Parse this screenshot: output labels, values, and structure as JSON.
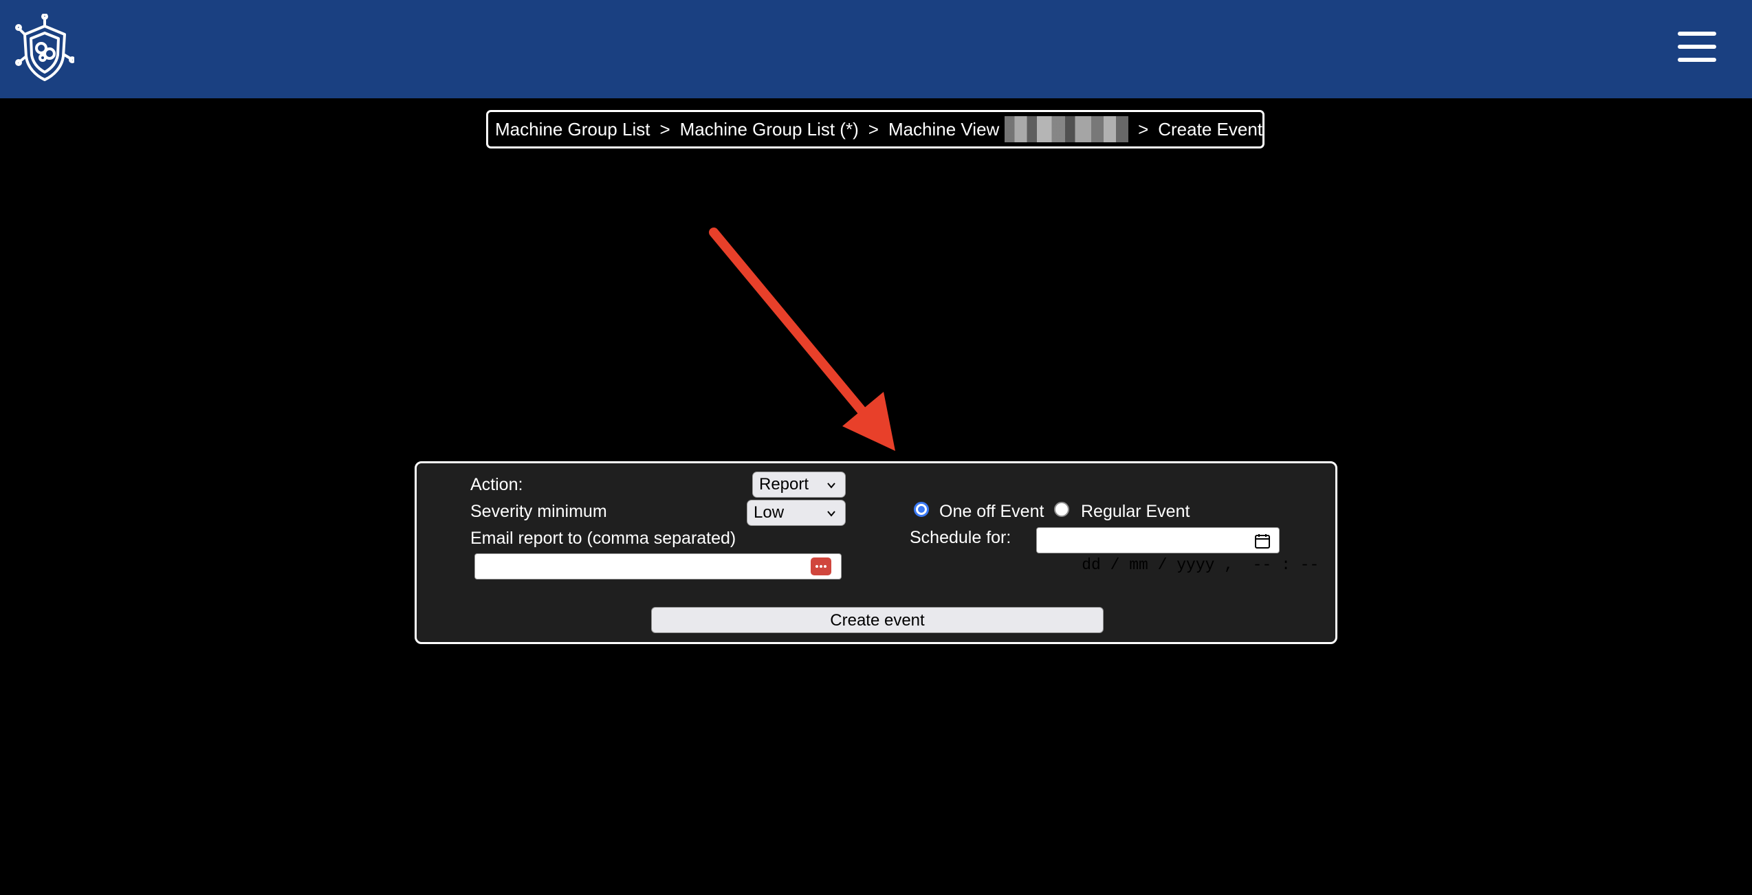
{
  "header": {
    "background_color": "#1a4081",
    "logo_icon": "shield-circuit-logo-icon",
    "menu_icon": "hamburger-menu-icon"
  },
  "breadcrumb": {
    "items": [
      {
        "label": "Machine Group List"
      },
      {
        "label": "Machine Group List (*)"
      },
      {
        "label": "Machine View"
      },
      {
        "label": "Create Event"
      }
    ],
    "separator": ">"
  },
  "annotation": {
    "arrow_color": "#e8402a"
  },
  "form": {
    "action_label": "Action:",
    "action_value": "Report",
    "severity_label": "Severity minimum",
    "severity_value": "Low",
    "email_label": "Email report to (comma separated)",
    "email_value": "",
    "event_type_options": [
      {
        "label": "One off Event",
        "selected": true
      },
      {
        "label": "Regular Event",
        "selected": false
      }
    ],
    "schedule_label": "Schedule for:",
    "schedule_placeholder": "dd / mm / yyyy ,  -- : --",
    "submit_label": "Create event"
  }
}
